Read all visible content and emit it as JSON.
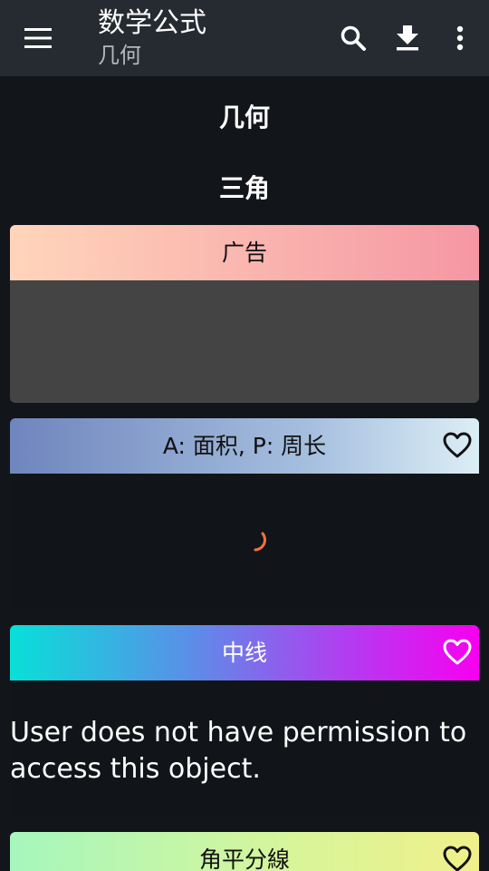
{
  "toolbar": {
    "title": "数学公式",
    "subtitle": "几何",
    "icons": [
      "menu-icon",
      "search-icon",
      "download-icon",
      "more-vert-icon"
    ]
  },
  "headings": {
    "section": "几何",
    "subsection": "三角"
  },
  "cards": [
    {
      "header": "广告",
      "type": "ad"
    },
    {
      "header": "A: 面积, P: 周长",
      "favorite": false,
      "state": "loading"
    },
    {
      "header": "中线",
      "favorite": false,
      "message": "User does not have permission to access this object."
    },
    {
      "header": "角平分線",
      "favorite": false
    }
  ],
  "colors": {
    "toolbar_bg": "#252b31",
    "page_bg": "#12151a",
    "spinner": "#f07040"
  }
}
